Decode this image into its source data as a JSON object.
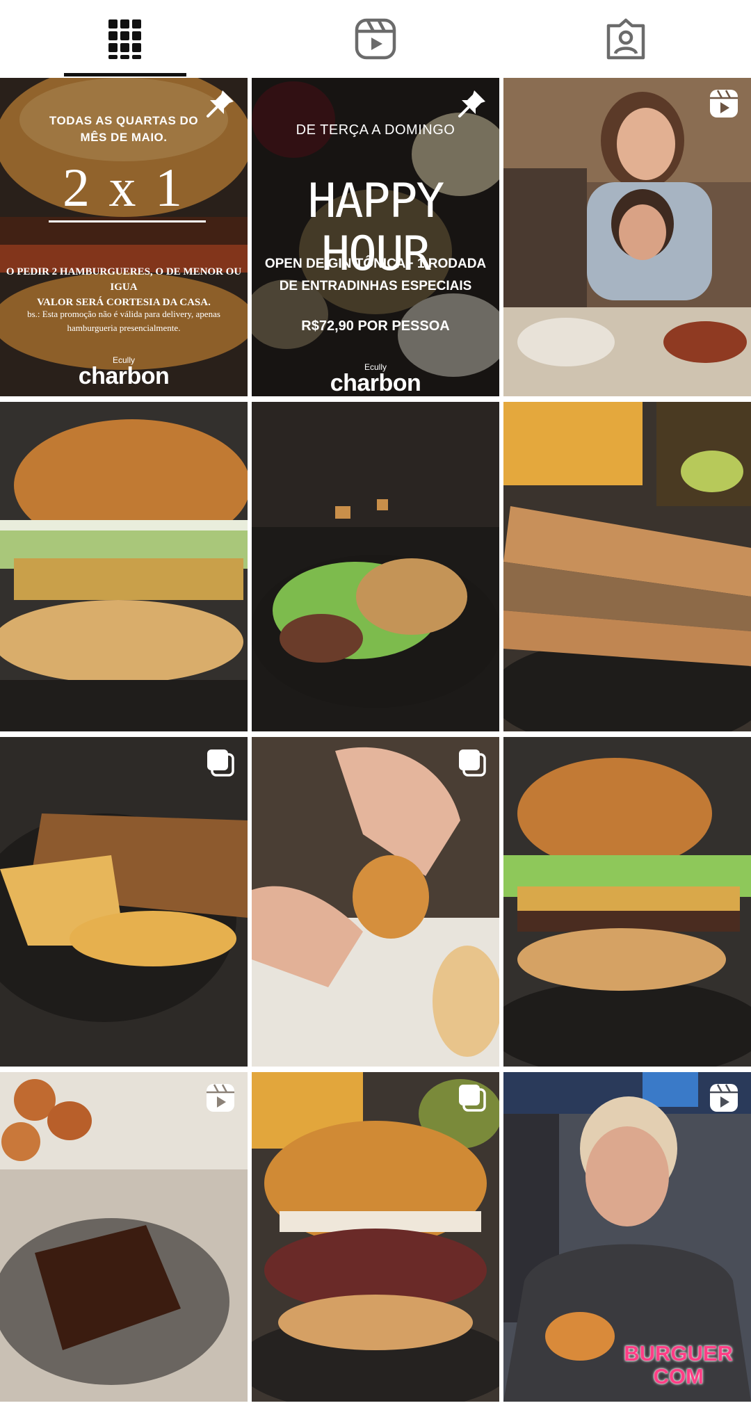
{
  "tabs": [
    {
      "icon": "grid-icon",
      "active": true
    },
    {
      "icon": "reels-icon",
      "active": false
    },
    {
      "icon": "tagged-icon",
      "active": false
    }
  ],
  "posts": [
    {
      "badge": "pin-icon",
      "lines": {
        "top": "TODAS AS QUARTAS DO\nMÊS DE MAIO.",
        "big": "2 x 1",
        "body": "O PEDIR 2 HAMBURGUERES, O DE MENOR OU IGUA\nVALOR SERÁ CORTESIA DA CASA.",
        "obs": "bs.: Esta promoção não é válida para delivery, apenas\nhamburgueria presencialmente.",
        "brand_small": "Ecully",
        "brand": "charbon"
      }
    },
    {
      "badge": "pin-icon",
      "lines": {
        "top": "DE TERÇA A DOMINGO",
        "big": "HAPPY HOUR",
        "body": "OPEN DE GIN TÔNICA+ 1 RODADA\nDE ENTRADINHAS ESPECIAIS",
        "price": "R$72,90 POR PESSOA",
        "brand_small": "Ecully",
        "brand": "charbon"
      }
    },
    {
      "badge": "reels-icon"
    },
    {
      "badge": ""
    },
    {
      "badge": ""
    },
    {
      "badge": ""
    },
    {
      "badge": "carousel-icon"
    },
    {
      "badge": "carousel-icon"
    },
    {
      "badge": ""
    },
    {
      "badge": "reels-icon"
    },
    {
      "badge": "carousel-icon"
    },
    {
      "badge": "reels-icon",
      "watermark": "BURGUER\nCOM"
    }
  ]
}
